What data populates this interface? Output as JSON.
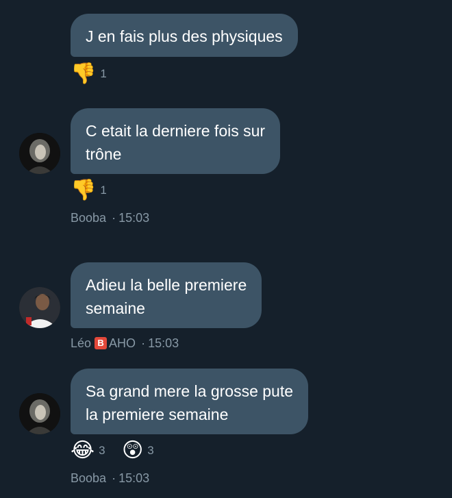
{
  "messages": [
    {
      "text": "J en fais plus des physiques",
      "reactions": [
        {
          "icon": "thumbs-down-emoji",
          "glyph": "👎",
          "count": "1"
        }
      ]
    },
    {
      "text": "C etait la derniere fois sur\ntrône",
      "reactions": [
        {
          "icon": "thumbs-down-emoji",
          "glyph": "👎",
          "count": "1"
        }
      ],
      "sender": "Booba",
      "separator": "·",
      "time": "15:03"
    },
    {
      "text": "Adieu la belle premiere\nsemaine",
      "sender": "Léo",
      "sender_badge": "B",
      "sender_suffix": "AHO",
      "separator": "·",
      "time": "15:03"
    },
    {
      "text": "Sa grand mere la grosse pute\nla premiere semaine",
      "reactions": [
        {
          "icon": "laughing-tears-emoji",
          "glyph": "😂",
          "count": "3"
        },
        {
          "icon": "surprised-face-emoji",
          "glyph": "😲",
          "count": "3"
        }
      ],
      "sender": "Booba",
      "separator": "·",
      "time": "15:03"
    }
  ],
  "colors": {
    "background": "#15202b",
    "bubble": "#3d5466",
    "meta_text": "#8899a6",
    "badge": "#e2483a"
  }
}
